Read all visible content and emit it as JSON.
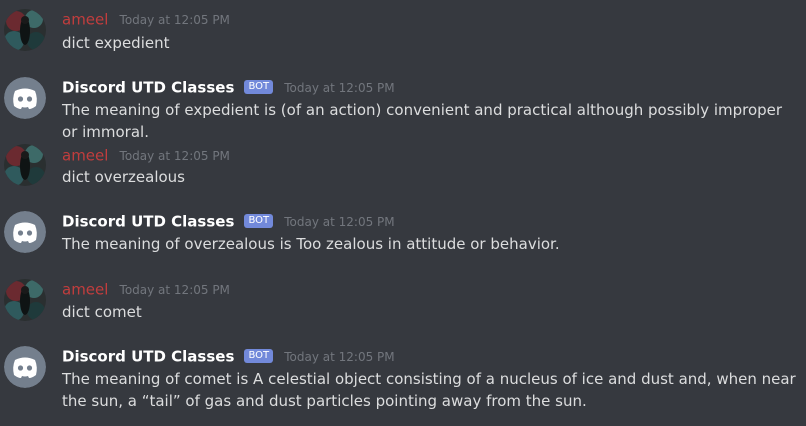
{
  "messages": [
    {
      "author": "ameel",
      "timestamp": "Today at 12:05 PM",
      "text": "dict expedient",
      "is_bot": false
    },
    {
      "author": "Discord UTD Classes",
      "bot_tag": "BOT",
      "timestamp": "Today at 12:05 PM",
      "text": "The meaning of expedient is (of an action) convenient and practical although possibly improper or immoral.",
      "is_bot": true
    },
    {
      "author": "ameel",
      "timestamp": "Today at 12:05 PM",
      "text": "dict overzealous",
      "is_bot": false
    },
    {
      "author": "Discord UTD Classes",
      "bot_tag": "BOT",
      "timestamp": "Today at 12:05 PM",
      "text": "The meaning of overzealous is Too zealous in attitude or behavior.",
      "is_bot": true
    },
    {
      "author": "ameel",
      "timestamp": "Today at 12:05 PM",
      "text": "dict comet",
      "is_bot": false
    },
    {
      "author": "Discord UTD Classes",
      "bot_tag": "BOT",
      "timestamp": "Today at 12:05 PM",
      "text": "The meaning of comet is A celestial object consisting of a nucleus of ice and dust and, when near the sun, a “tail” of gas and dust particles pointing away from the sun.",
      "is_bot": true
    }
  ],
  "colors": {
    "background": "#36393f",
    "user_name": "#c23d3d",
    "bot_name": "#ffffff",
    "bot_tag": "#7289da",
    "timestamp": "#72767d",
    "message_text": "#dcddde",
    "discord_avatar": "#747f8d"
  }
}
